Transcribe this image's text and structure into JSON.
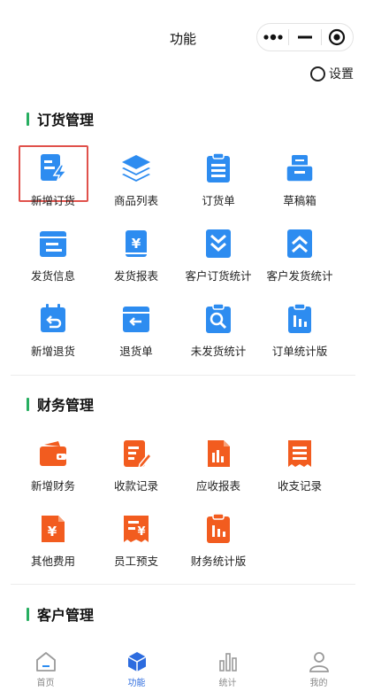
{
  "header": {
    "title": "功能",
    "settings_label": "设置"
  },
  "capsule": {
    "more_icon": "more-dots-icon",
    "minimize_icon": "minimize-icon",
    "close_icon": "target-circle-icon"
  },
  "sections": [
    {
      "title": "订货管理",
      "items": [
        {
          "label": "新增订货",
          "icon": "new-order-icon"
        },
        {
          "label": "商品列表",
          "icon": "stack-layers-icon"
        },
        {
          "label": "订货单",
          "icon": "clipboard-icon"
        },
        {
          "label": "草稿箱",
          "icon": "drafts-box-icon"
        },
        {
          "label": "发货信息",
          "icon": "shipping-info-icon"
        },
        {
          "label": "发货报表",
          "icon": "yen-report-icon"
        },
        {
          "label": "客户订货统计",
          "icon": "double-chevron-down-icon"
        },
        {
          "label": "客户发货统计",
          "icon": "double-chevron-up-icon"
        },
        {
          "label": "新增退货",
          "icon": "return-calendar-icon"
        },
        {
          "label": "退货单",
          "icon": "return-box-icon"
        },
        {
          "label": "未发货统计",
          "icon": "search-clipboard-icon"
        },
        {
          "label": "订单统计版",
          "icon": "bar-chart-clipboard-icon"
        }
      ]
    },
    {
      "title": "财务管理",
      "items": [
        {
          "label": "新增财务",
          "icon": "wallet-icon"
        },
        {
          "label": "收款记录",
          "icon": "edit-note-icon"
        },
        {
          "label": "应收报表",
          "icon": "chart-doc-icon"
        },
        {
          "label": "收支记录",
          "icon": "receipt-icon"
        },
        {
          "label": "其他费用",
          "icon": "yen-doc-icon"
        },
        {
          "label": "员工预支",
          "icon": "yen-receipt-icon"
        },
        {
          "label": "财务统计版",
          "icon": "bar-chart-clipboard-icon"
        }
      ]
    },
    {
      "title": "客户管理",
      "items": []
    }
  ],
  "tabbar": [
    {
      "label": "首页",
      "icon": "home-icon",
      "active": false
    },
    {
      "label": "功能",
      "icon": "cube-icon",
      "active": true
    },
    {
      "label": "统计",
      "icon": "bar-stats-icon",
      "active": false
    },
    {
      "label": "我的",
      "icon": "user-icon",
      "active": false
    }
  ],
  "colors": {
    "primary_blue": "#2d8cf0",
    "finance_orange": "#f25c1f",
    "accent_green": "#27ae60",
    "highlight_red": "#e0514b",
    "active_tab": "#2d6cdf"
  }
}
